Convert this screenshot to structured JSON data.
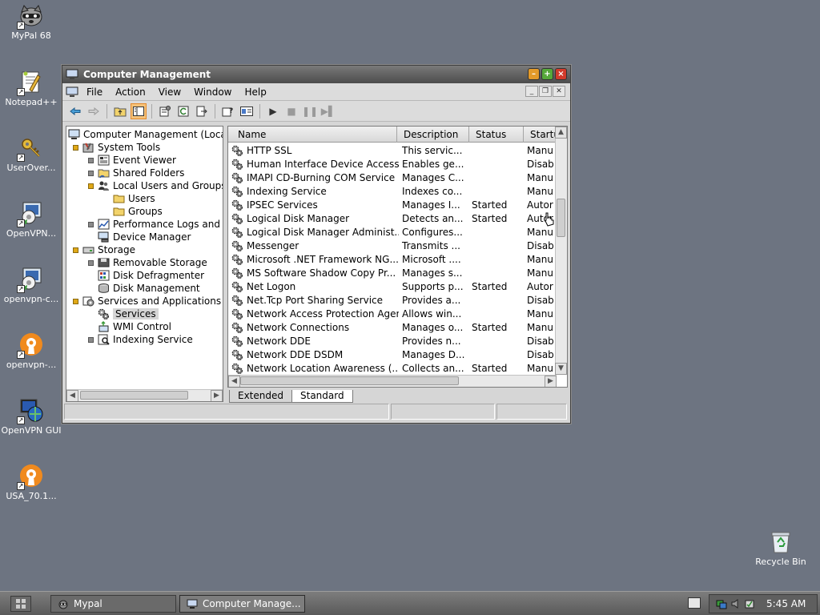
{
  "desktop": {
    "icons": [
      {
        "label": "MyPal 68",
        "icon": "raccoon-icon"
      },
      {
        "label": "Notepad++",
        "icon": "notepad-plus-icon"
      },
      {
        "label": "UserOver...",
        "icon": "key-icon"
      },
      {
        "label": "OpenVPN...",
        "icon": "openvpn-installer-icon"
      },
      {
        "label": "openvpn-c...",
        "icon": "openvpn-installer-icon"
      },
      {
        "label": "openvpn-...",
        "icon": "openvpn-lock-icon"
      },
      {
        "label": "OpenVPN GUI",
        "icon": "openvpn-gui-icon"
      },
      {
        "label": "USA_70.1...",
        "icon": "openvpn-lock-icon"
      },
      {
        "label": "Recycle Bin",
        "icon": "recycle-bin-icon"
      }
    ]
  },
  "window": {
    "title": "Computer Management",
    "menu": [
      "File",
      "Action",
      "View",
      "Window",
      "Help"
    ],
    "toolbar": [
      "back-icon",
      "forward-icon",
      "up-folder-icon",
      "show-tree-icon",
      "properties-icon",
      "refresh-icon",
      "export-icon",
      "help-icon",
      "console-icon",
      "play-icon",
      "stop-icon",
      "pause-icon",
      "restart-icon"
    ]
  },
  "tree": {
    "items": [
      {
        "label": "Computer Management (Local",
        "icon": "computer-icon",
        "exp": "none",
        "level": 0
      },
      {
        "label": "System Tools",
        "icon": "tools-icon",
        "exp": "open",
        "level": 1
      },
      {
        "label": "Event Viewer",
        "icon": "event-viewer-icon",
        "exp": "closed",
        "level": 2
      },
      {
        "label": "Shared Folders",
        "icon": "shared-folder-icon",
        "exp": "closed",
        "level": 2
      },
      {
        "label": "Local Users and Groups",
        "icon": "users-icon",
        "exp": "open",
        "level": 2
      },
      {
        "label": "Users",
        "icon": "folder-icon",
        "exp": "none",
        "level": 3
      },
      {
        "label": "Groups",
        "icon": "folder-icon",
        "exp": "none",
        "level": 3
      },
      {
        "label": "Performance Logs and A",
        "icon": "performance-icon",
        "exp": "closed",
        "level": 2
      },
      {
        "label": "Device Manager",
        "icon": "device-manager-icon",
        "exp": "none",
        "level": 2
      },
      {
        "label": "Storage",
        "icon": "storage-icon",
        "exp": "open",
        "level": 1
      },
      {
        "label": "Removable Storage",
        "icon": "removable-storage-icon",
        "exp": "closed",
        "level": 2
      },
      {
        "label": "Disk Defragmenter",
        "icon": "defrag-icon",
        "exp": "none",
        "level": 2
      },
      {
        "label": "Disk Management",
        "icon": "disk-management-icon",
        "exp": "none",
        "level": 2
      },
      {
        "label": "Services and Applications",
        "icon": "services-apps-icon",
        "exp": "open",
        "level": 1
      },
      {
        "label": "Services",
        "icon": "gear-icon",
        "exp": "none",
        "level": 2,
        "selected": true
      },
      {
        "label": "WMI Control",
        "icon": "wmi-icon",
        "exp": "none",
        "level": 2
      },
      {
        "label": "Indexing Service",
        "icon": "indexing-icon",
        "exp": "closed",
        "level": 2
      }
    ]
  },
  "list": {
    "columns": [
      "Name",
      "Description",
      "Status",
      "Startu"
    ],
    "rows": [
      [
        "HTTP SSL",
        "This servic...",
        "",
        "Manu"
      ],
      [
        "Human Interface Device Access",
        "Enables ge...",
        "",
        "Disab"
      ],
      [
        "IMAPI CD-Burning COM Service",
        "Manages C...",
        "",
        "Manu"
      ],
      [
        "Indexing Service",
        "Indexes co...",
        "",
        "Manu"
      ],
      [
        "IPSEC Services",
        "Manages I...",
        "Started",
        "Autor"
      ],
      [
        "Logical Disk Manager",
        "Detects an...",
        "Started",
        "Autor"
      ],
      [
        "Logical Disk Manager Administ...",
        "Configures...",
        "",
        "Manu"
      ],
      [
        "Messenger",
        "Transmits ...",
        "",
        "Disab"
      ],
      [
        "Microsoft .NET Framework NG...",
        "Microsoft ....",
        "",
        "Manu"
      ],
      [
        "MS Software Shadow Copy Pr...",
        "Manages s...",
        "",
        "Manu"
      ],
      [
        "Net Logon",
        "Supports p...",
        "Started",
        "Autor"
      ],
      [
        "Net.Tcp Port Sharing Service",
        "Provides a...",
        "",
        "Disab"
      ],
      [
        "Network Access Protection Agent",
        "Allows win...",
        "",
        "Manu"
      ],
      [
        "Network Connections",
        "Manages o...",
        "Started",
        "Manu"
      ],
      [
        "Network DDE",
        "Provides n...",
        "",
        "Disab"
      ],
      [
        "Network DDE DSDM",
        "Manages D...",
        "",
        "Disab"
      ],
      [
        "Network Location Awareness (...",
        "Collects an...",
        "Started",
        "Manu"
      ]
    ]
  },
  "tabs": [
    "Extended",
    "Standard"
  ],
  "taskbar": {
    "tasks": [
      "Mypal",
      "Computer Manage..."
    ],
    "clock": "5:45 AM"
  }
}
